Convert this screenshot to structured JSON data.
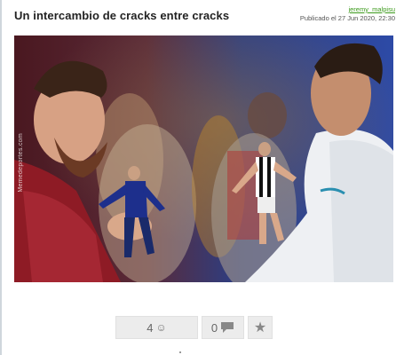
{
  "post": {
    "title": "Un intercambio de cracks entre cracks",
    "author": "jeremy_malpisu",
    "published": "Publicado el 27 Jun 2020, 22:30"
  },
  "image": {
    "watermark": "Memedeportes.com",
    "description_icon": "meme-photo"
  },
  "votes": {
    "likes": "4",
    "like_icon": "smiley-icon",
    "dislikes": "0",
    "dislike_icon": "speech-bubble-icon",
    "favorite_icon": "star-icon"
  },
  "colors": {
    "author_link": "#3c9a1c",
    "button_bg": "#ececec",
    "title": "#222222"
  }
}
